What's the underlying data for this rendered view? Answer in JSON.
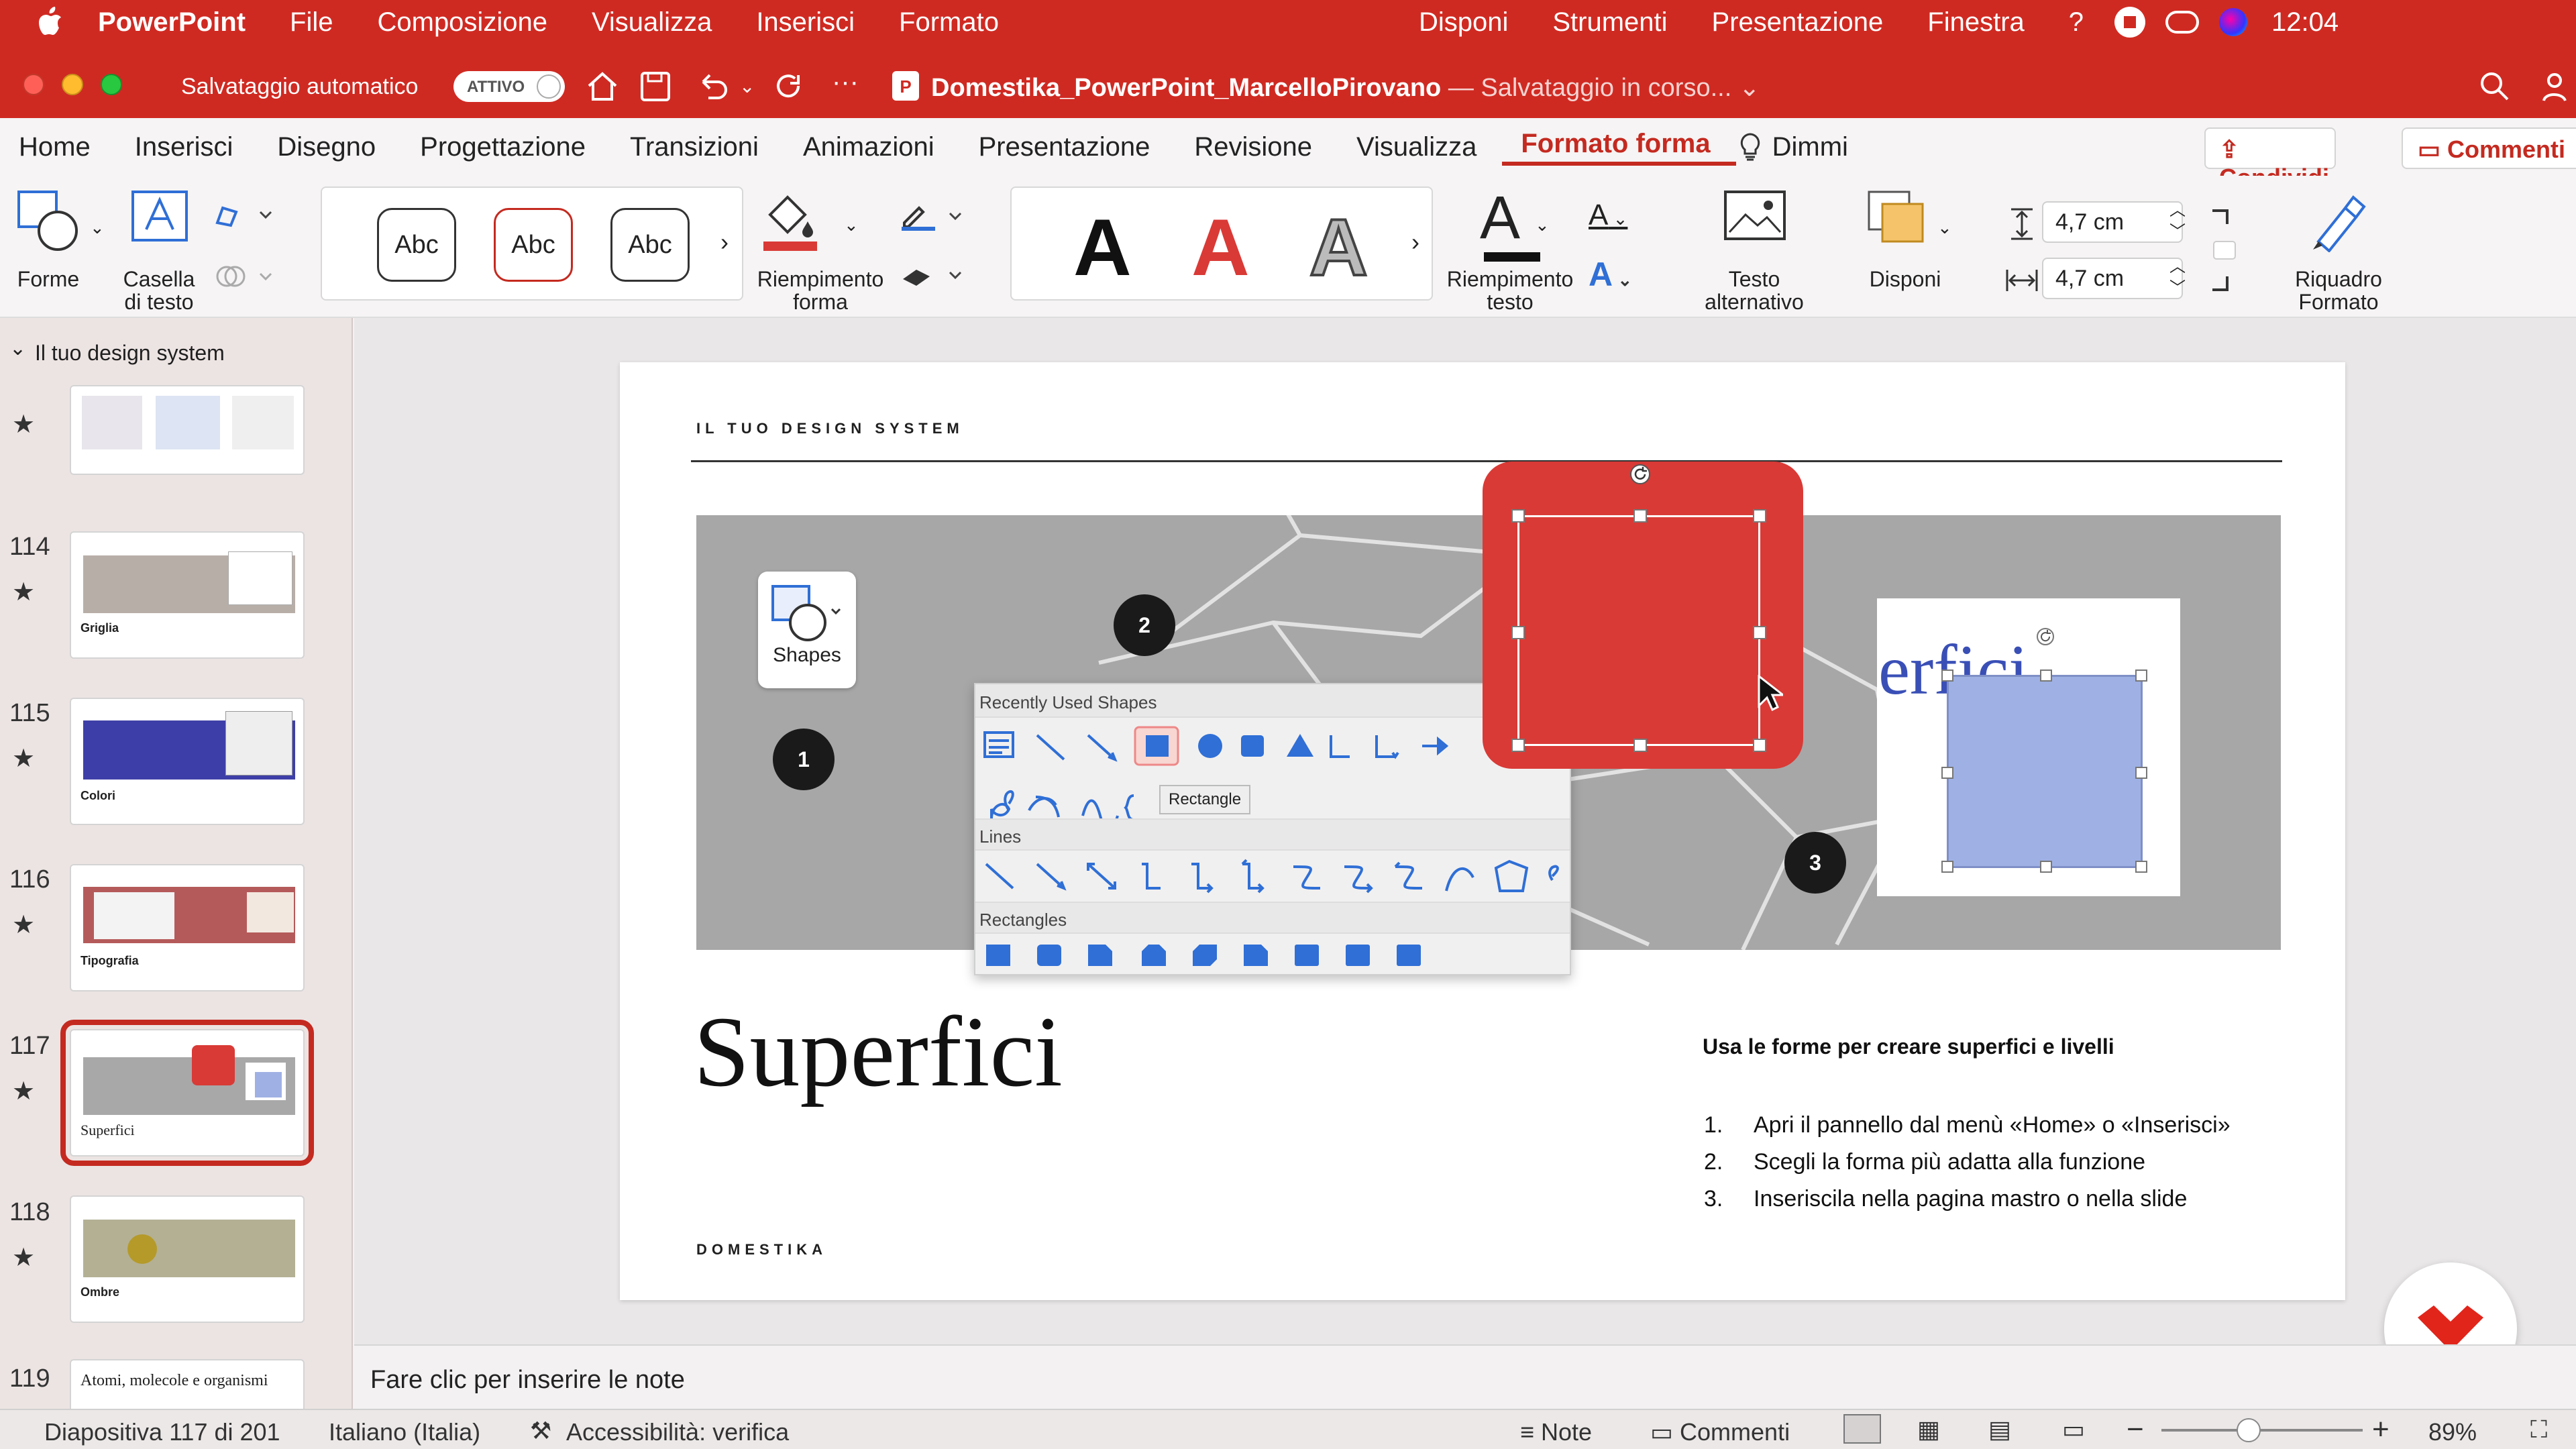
{
  "menubar": {
    "app_name": "PowerPoint",
    "items": [
      "File",
      "Composizione",
      "Visualizza",
      "Inserisci",
      "Formato",
      "Disponi",
      "Strumenti",
      "Presentazione",
      "Finestra",
      "?"
    ],
    "clock": "12:04"
  },
  "titlebar": {
    "autosave_label": "Salvataggio automatico",
    "autosave_state": "ATTIVO",
    "document_title": "Domestika_PowerPoint_MarcelloPirovano",
    "save_status": "— Salvataggio in corso..."
  },
  "tabs": [
    "Home",
    "Inserisci",
    "Disegno",
    "Progettazione",
    "Transizioni",
    "Animazioni",
    "Presentazione",
    "Revisione",
    "Visualizza",
    "Formato forma",
    "Dimmi"
  ],
  "share_button": "Condividi",
  "comments_button": "Commenti",
  "ribbon": {
    "shapes_label": "Forme",
    "textbox_label_1": "Casella",
    "textbox_label_2": "di testo",
    "style_abc": "Abc",
    "shape_fill_1": "Riempimento",
    "shape_fill_2": "forma",
    "text_fill_1": "Riempimento",
    "text_fill_2": "testo",
    "alt_text_1": "Testo",
    "alt_text_2": "alternativo",
    "arrange_label": "Disponi",
    "height_value": "4,7 cm",
    "width_value": "4,7 cm",
    "format_pane_1": "Riquadro",
    "format_pane_2": "Formato",
    "wordart_letter": "A"
  },
  "sidebar": {
    "section_title": "Il tuo design system",
    "slides": [
      {
        "num": "",
        "title": ""
      },
      {
        "num": "114",
        "title": "Griglia"
      },
      {
        "num": "115",
        "title": "Colori"
      },
      {
        "num": "116",
        "title": "Tipografia"
      },
      {
        "num": "117",
        "title": "Superfici"
      },
      {
        "num": "118",
        "title": "Ombre"
      },
      {
        "num": "119",
        "title": "Atomi, molecole e organismi"
      }
    ],
    "star": "★"
  },
  "slide": {
    "header": "IL TUO DESIGN SYSTEM",
    "footer": "DOMESTIKA",
    "title": "Superfici",
    "subtitle": "Usa le forme per creare superfici e livelli",
    "steps": [
      {
        "n": "1.",
        "text": "Apri il pannello dal menù «Home» o «Inserisci»"
      },
      {
        "n": "2.",
        "text": "Scegli la forma più adatta alla funzione"
      },
      {
        "n": "3.",
        "text": "Inseriscila nella pagina mastro o nella slide"
      }
    ],
    "shapes_button": "Shapes",
    "badge_1": "1",
    "badge_2": "2",
    "badge_3": "3",
    "popup": {
      "recent": "Recently Used Shapes",
      "lines": "Lines",
      "rectangles": "Rectangles",
      "tooltip": "Rectangle"
    },
    "overlay_text": "erfici"
  },
  "notes_placeholder": "Fare clic per inserire le note",
  "status": {
    "slide_info": "Diapositiva 117 di 201",
    "language": "Italiano (Italia)",
    "accessibility": "Accessibilità: verifica",
    "notes": "Note",
    "comments": "Commenti",
    "zoom": "89%"
  },
  "colors": {
    "accent": "#cf2a22",
    "shape_red": "#d93a36",
    "shape_blue": "#9fb1e4",
    "popup_blue": "#2f6fd6"
  }
}
